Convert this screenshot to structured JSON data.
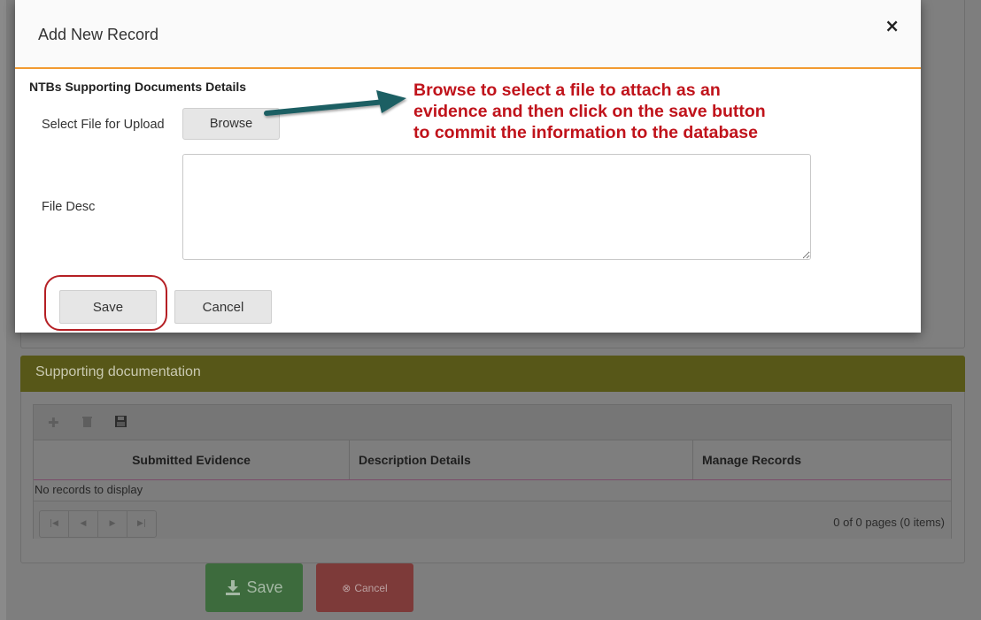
{
  "modal": {
    "title": "Add New Record",
    "close_label": "×",
    "section_title": "NTBs Supporting Documents Details",
    "file_label": "Select File for Upload",
    "browse_label": "Browse",
    "desc_label": "File Desc",
    "desc_value": "",
    "save_label": "Save",
    "cancel_label": "Cancel"
  },
  "annotation": {
    "lines": [
      "Browse to select a file to attach as an",
      "evidence and then click on the save button",
      "to commit the information to the database"
    ],
    "color": "#c0131b",
    "arrow_color": "#1f5f63"
  },
  "supporting_docs": {
    "title": "Supporting documentation",
    "toolbar_icons": [
      "plus-icon",
      "trash-icon",
      "floppy-disk-icon"
    ],
    "columns": [
      "Submitted Evidence",
      "Description Details",
      "Manage Records"
    ],
    "empty_message": "No records to display",
    "pager_icons": [
      "first-page-icon",
      "prev-page-icon",
      "next-page-icon",
      "last-page-icon"
    ],
    "pager_info": "0 of 0 pages (0 items)"
  },
  "page_buttons": {
    "save_label": "Save",
    "cancel_label": "Cancel",
    "save_color": "#5cb85c",
    "cancel_color": "#d9534f"
  },
  "colors": {
    "modal_header_border": "#f29a31",
    "section_header_bg": "#6f6f1e",
    "highlight_ring": "#b51f24"
  }
}
